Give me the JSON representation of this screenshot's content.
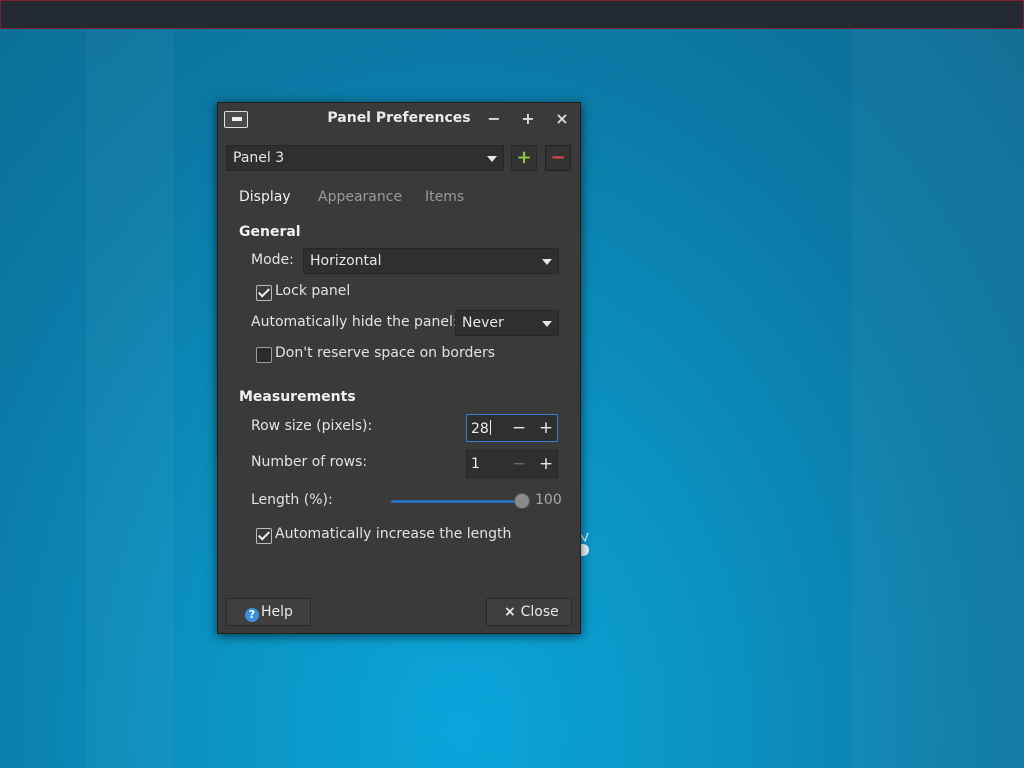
{
  "dialog": {
    "title": "Panel Preferences",
    "window_controls": {
      "minimize": "−",
      "maximize": "+",
      "close": "×"
    },
    "panel_selector": {
      "value": "Panel 3"
    },
    "add_panel_icon": "plus-icon",
    "remove_panel_icon": "minus-icon",
    "tabs": [
      {
        "label": "Display",
        "active": true
      },
      {
        "label": "Appearance",
        "active": false
      },
      {
        "label": "Items",
        "active": false
      }
    ],
    "general": {
      "heading": "General",
      "mode_label": "Mode:",
      "mode_value": "Horizontal",
      "lock_panel_label": "Lock panel",
      "lock_panel_checked": true,
      "autohide_label": "Automatically hide the panel:",
      "autohide_value": "Never",
      "reserve_label": "Don't reserve space on borders",
      "reserve_checked": false
    },
    "measurements": {
      "heading": "Measurements",
      "row_size_label": "Row size (pixels):",
      "row_size_value": "28",
      "rows_label": "Number of rows:",
      "rows_value": "1",
      "length_label": "Length (%):",
      "length_value": "100",
      "length_fraction": 1.0,
      "auto_length_label": "Automatically increase the length",
      "auto_length_checked": true
    },
    "buttons": {
      "help": "Help",
      "close": "Close"
    }
  },
  "colors": {
    "accent": "#3a7bd5",
    "add_green": "#8cc63f",
    "remove_red": "#e04848",
    "desktop_blue": "#0b94c4"
  }
}
